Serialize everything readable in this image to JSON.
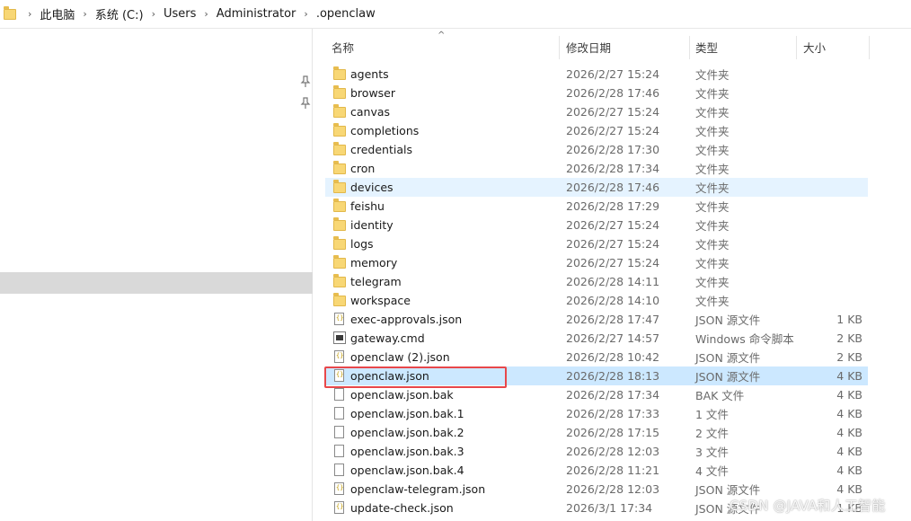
{
  "breadcrumb": {
    "items": [
      "此电脑",
      "系统 (C:)",
      "Users",
      "Administrator",
      ".openclaw"
    ],
    "separator": "›"
  },
  "columns": {
    "name": "名称",
    "date": "修改日期",
    "type": "类型",
    "size": "大小"
  },
  "files": [
    {
      "name": "agents",
      "date": "2026/2/27 15:24",
      "type": "文件夹",
      "size": "",
      "icon": "folder-icon"
    },
    {
      "name": "browser",
      "date": "2026/2/28 17:46",
      "type": "文件夹",
      "size": "",
      "icon": "folder-icon"
    },
    {
      "name": "canvas",
      "date": "2026/2/27 15:24",
      "type": "文件夹",
      "size": "",
      "icon": "folder-icon"
    },
    {
      "name": "completions",
      "date": "2026/2/27 15:24",
      "type": "文件夹",
      "size": "",
      "icon": "folder-icon"
    },
    {
      "name": "credentials",
      "date": "2026/2/28 17:30",
      "type": "文件夹",
      "size": "",
      "icon": "folder-icon"
    },
    {
      "name": "cron",
      "date": "2026/2/28 17:34",
      "type": "文件夹",
      "size": "",
      "icon": "folder-icon"
    },
    {
      "name": "devices",
      "date": "2026/2/28 17:46",
      "type": "文件夹",
      "size": "",
      "icon": "folder-icon"
    },
    {
      "name": "feishu",
      "date": "2026/2/28 17:29",
      "type": "文件夹",
      "size": "",
      "icon": "folder-icon"
    },
    {
      "name": "identity",
      "date": "2026/2/27 15:24",
      "type": "文件夹",
      "size": "",
      "icon": "folder-icon"
    },
    {
      "name": "logs",
      "date": "2026/2/27 15:24",
      "type": "文件夹",
      "size": "",
      "icon": "folder-icon"
    },
    {
      "name": "memory",
      "date": "2026/2/27 15:24",
      "type": "文件夹",
      "size": "",
      "icon": "folder-icon"
    },
    {
      "name": "telegram",
      "date": "2026/2/28 14:11",
      "type": "文件夹",
      "size": "",
      "icon": "folder-icon"
    },
    {
      "name": "workspace",
      "date": "2026/2/28 14:10",
      "type": "文件夹",
      "size": "",
      "icon": "folder-icon"
    },
    {
      "name": "exec-approvals.json",
      "date": "2026/2/28 17:47",
      "type": "JSON 源文件",
      "size": "1 KB",
      "icon": "json-file-icon"
    },
    {
      "name": "gateway.cmd",
      "date": "2026/2/27 14:57",
      "type": "Windows 命令脚本",
      "size": "2 KB",
      "icon": "cmd-file-icon"
    },
    {
      "name": "openclaw (2).json",
      "date": "2026/2/28 10:42",
      "type": "JSON 源文件",
      "size": "2 KB",
      "icon": "json-file-icon"
    },
    {
      "name": "openclaw.json",
      "date": "2026/2/28 18:13",
      "type": "JSON 源文件",
      "size": "4 KB",
      "icon": "json-file-icon"
    },
    {
      "name": "openclaw.json.bak",
      "date": "2026/2/28 17:34",
      "type": "BAK 文件",
      "size": "4 KB",
      "icon": "file-icon"
    },
    {
      "name": "openclaw.json.bak.1",
      "date": "2026/2/28 17:33",
      "type": "1 文件",
      "size": "4 KB",
      "icon": "file-icon"
    },
    {
      "name": "openclaw.json.bak.2",
      "date": "2026/2/28 17:15",
      "type": "2 文件",
      "size": "4 KB",
      "icon": "file-icon"
    },
    {
      "name": "openclaw.json.bak.3",
      "date": "2026/2/28 12:03",
      "type": "3 文件",
      "size": "4 KB",
      "icon": "file-icon"
    },
    {
      "name": "openclaw.json.bak.4",
      "date": "2026/2/28 11:21",
      "type": "4 文件",
      "size": "4 KB",
      "icon": "file-icon"
    },
    {
      "name": "openclaw-telegram.json",
      "date": "2026/2/28 12:03",
      "type": "JSON 源文件",
      "size": "4 KB",
      "icon": "json-file-icon"
    },
    {
      "name": "update-check.json",
      "date": "2026/3/1 17:34",
      "type": "JSON 源文件",
      "size": "1 KB",
      "icon": "json-file-icon"
    }
  ],
  "hovered_row": 6,
  "selected_row": 16,
  "watermark": "CSDN @JAVA和人工智能",
  "colors": {
    "selected_row": "#cce8ff",
    "hover_row": "#e5f3ff",
    "highlight_box": "#e8474a",
    "folder": "#f8d775"
  }
}
